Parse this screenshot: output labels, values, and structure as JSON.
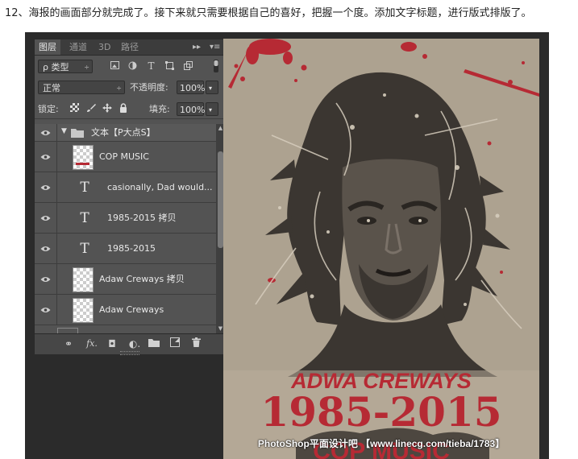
{
  "caption": "12、海报的画面部分就完成了。接下来就只需要根据自己的喜好，把握一个度。添加文字标题，进行版式排版了。",
  "panel": {
    "tabs": [
      {
        "label": "图层",
        "active": true
      },
      {
        "label": "通道",
        "active": false
      },
      {
        "label": "3D",
        "active": false
      },
      {
        "label": "路径",
        "active": false
      }
    ],
    "collapse_label": "▸▸",
    "menu_label": "▾≡",
    "filter": {
      "label": "ρ 类型",
      "arrow": "÷"
    },
    "blend_mode": {
      "value": "正常",
      "arrow": "÷"
    },
    "opacity": {
      "label": "不透明度:",
      "value": "100%",
      "arrow": "▾"
    },
    "lock": {
      "label": "锁定:"
    },
    "fill": {
      "label": "填充:",
      "value": "100%",
      "arrow": "▾"
    },
    "layers": [
      {
        "type": "group",
        "name": "文本【P大点S】"
      },
      {
        "type": "raster",
        "name": "COP MUSIC"
      },
      {
        "type": "text",
        "name": "casionally, Dad would..."
      },
      {
        "type": "text",
        "name": "1985-2015 拷贝"
      },
      {
        "type": "text",
        "name": "1985-2015"
      },
      {
        "type": "raster",
        "name": "Adaw Creways 拷贝"
      },
      {
        "type": "raster",
        "name": "Adaw Creways"
      }
    ],
    "text_icon": "T",
    "bottom_icons": {
      "link": "⚭",
      "fx": "fx.",
      "mask": "◘",
      "adjust": "◐.",
      "folder": "▬",
      "new": "◪",
      "trash": "🗑"
    }
  },
  "poster": {
    "name_text": "ADWA CREWAYS",
    "years_text": "1985-2015",
    "music_text": "COP MUSIC",
    "watermark": "PhotoShop平面设计吧 【www.linecg.com/tieba/1783】",
    "colors": {
      "paper": "#b9ad9a",
      "ink": "#3b3631",
      "accent": "#b62a34"
    }
  }
}
